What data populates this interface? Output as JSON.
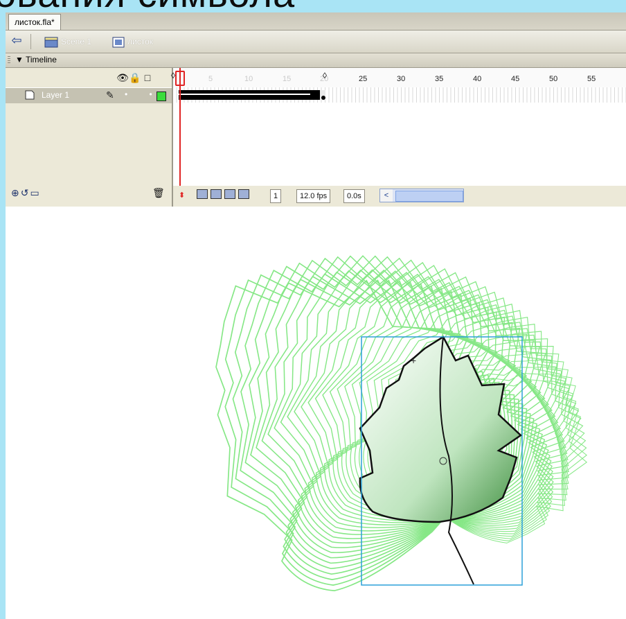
{
  "slide": {
    "title_fragment": "ования символа"
  },
  "document": {
    "tab_title": "листок.fla*"
  },
  "editbar": {
    "back_icon": "back-arrow-icon",
    "scene_label": "Scene 1",
    "symbol_label": "листок"
  },
  "timeline": {
    "panel_title": "Timeline",
    "header_icons": [
      "eye-icon",
      "lock-icon",
      "outline-icon"
    ],
    "layer": {
      "name": "Layer 1",
      "color": "#3bdc3b"
    },
    "ruler_labels": [
      "5",
      "10",
      "15",
      "20",
      "25",
      "30",
      "35",
      "40",
      "45",
      "50",
      "55"
    ],
    "current_frame": "1",
    "frame_rate": "12.0 fps",
    "elapsed_time": "0.0s"
  },
  "colors": {
    "accent": "#2ba0d8",
    "playhead": "#e02424",
    "outline": "#5ee05e",
    "background": "#a9e4f5"
  }
}
